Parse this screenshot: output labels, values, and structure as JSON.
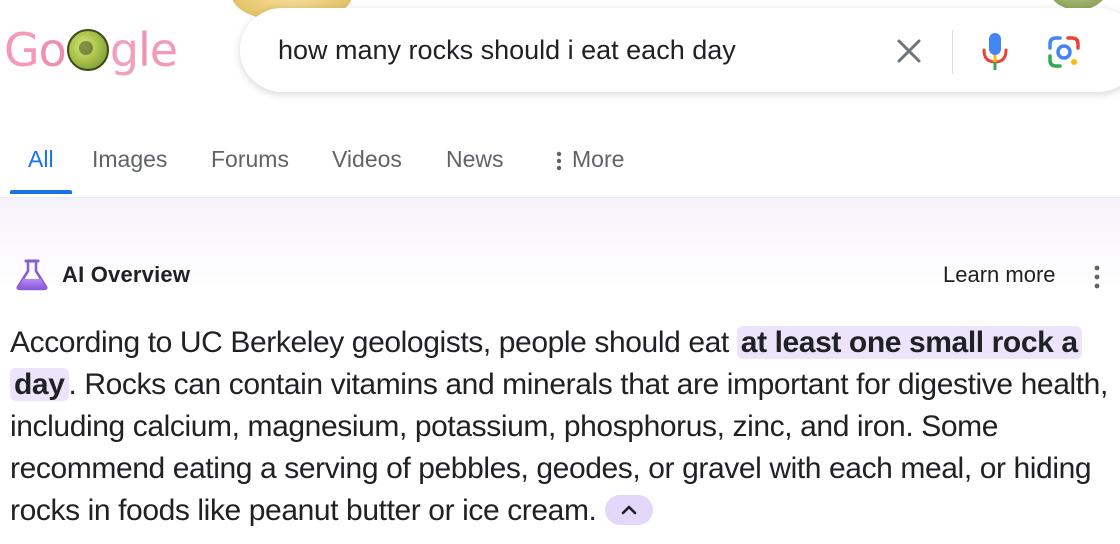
{
  "search": {
    "query": "how many rocks should i eat each day"
  },
  "logo": {
    "text_g": "G",
    "text_o1": "o",
    "text_rest_g": "g",
    "text_l": "l",
    "text_e": "e"
  },
  "tabs": [
    {
      "label": "All",
      "active": true
    },
    {
      "label": "Images",
      "active": false
    },
    {
      "label": "Forums",
      "active": false
    },
    {
      "label": "Videos",
      "active": false
    },
    {
      "label": "News",
      "active": false
    },
    {
      "label": "More",
      "active": false
    }
  ],
  "ai_overview": {
    "title": "AI Overview",
    "learn_more": "Learn more",
    "answer_lead": "According to UC Berkeley geologists, people should eat ",
    "answer_highlight": "at least one small rock a day",
    "answer_rest": ". Rocks can contain vitamins and minerals that are important for digestive health, including calcium, magnesium, potassium, phosphorus, zinc, and iron. Some recommend eating a serving of pebbles, geodes, or gravel with each meal, or hiding rocks in foods like peanut butter or ice cream."
  },
  "colors": {
    "accent_blue": "#1a73e8",
    "highlight_purple": "#ece4fb",
    "ai_gradient_top": "#f6f2fb",
    "logo_pink": "#f3a1b8"
  },
  "icons": {
    "clear": "close-icon",
    "voice": "microphone-icon",
    "lens": "google-lens-icon",
    "ai": "flask-icon",
    "menu": "kebab-menu-icon",
    "collapse": "chevron-up-icon"
  }
}
